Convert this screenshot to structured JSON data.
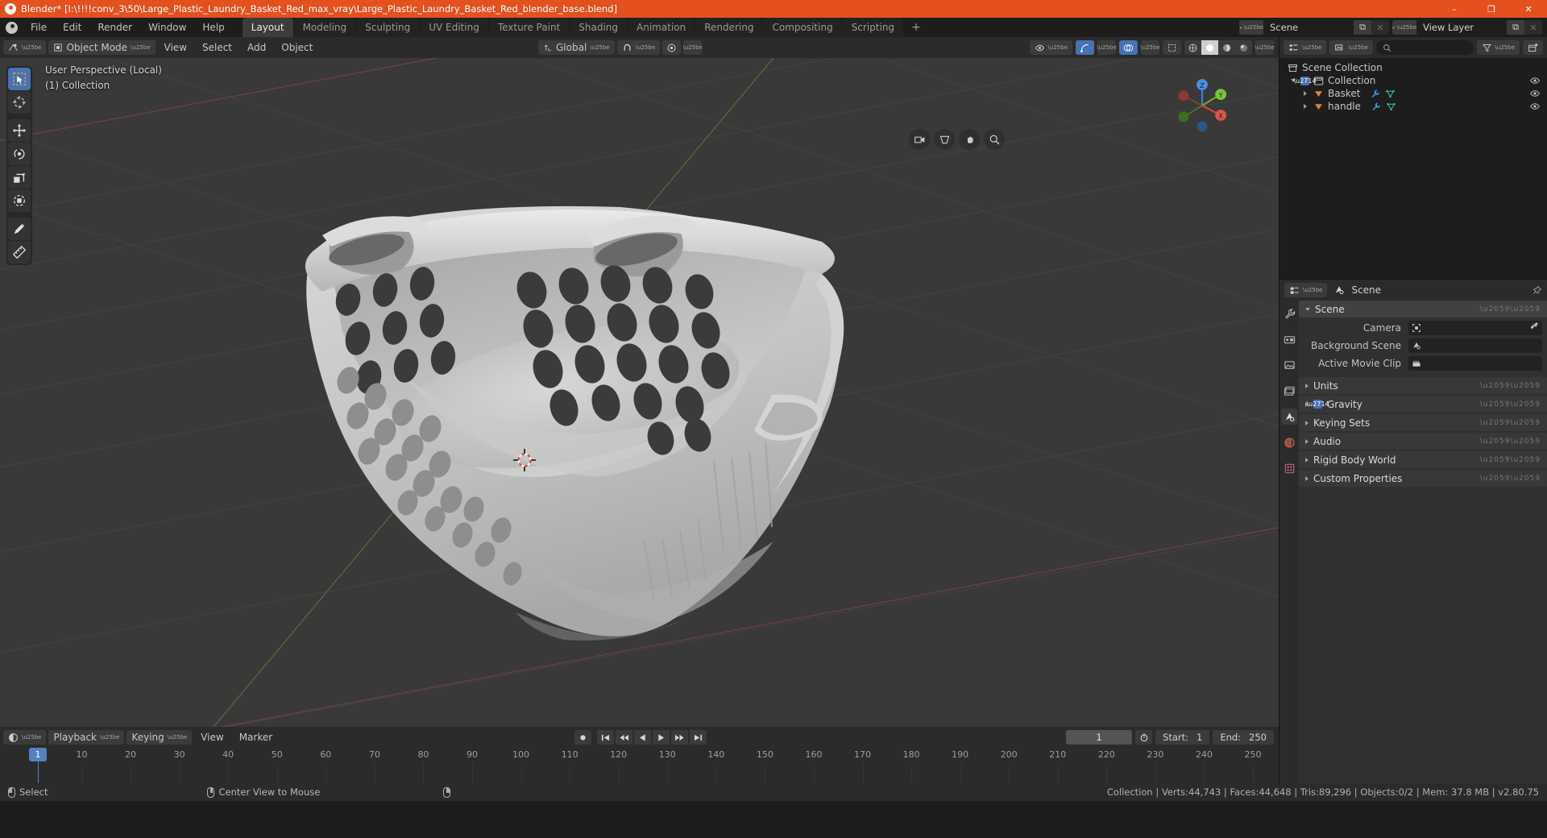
{
  "titlebar": {
    "app": "Blender*",
    "full_title": "Blender* [I:\\!!!!conv_3\\50\\Large_Plastic_Laundry_Basket_Red_max_vray\\Large_Plastic_Laundry_Basket_Red_blender_base.blend]",
    "minimize": "–",
    "maximize": "❐",
    "close": "✕"
  },
  "topbar": {
    "menus": [
      "File",
      "Edit",
      "Render",
      "Window",
      "Help"
    ],
    "workspaces": [
      {
        "label": "Layout",
        "active": true
      },
      {
        "label": "Modeling",
        "active": false
      },
      {
        "label": "Sculpting",
        "active": false
      },
      {
        "label": "UV Editing",
        "active": false
      },
      {
        "label": "Texture Paint",
        "active": false
      },
      {
        "label": "Shading",
        "active": false
      },
      {
        "label": "Animation",
        "active": false
      },
      {
        "label": "Rendering",
        "active": false
      },
      {
        "label": "Compositing",
        "active": false
      },
      {
        "label": "Scripting",
        "active": false
      }
    ],
    "add_workspace": "+",
    "scene_name": "Scene",
    "view_layer_name": "View Layer",
    "new_copy": "⧉",
    "unlink": "✕"
  },
  "viewport_header": {
    "editor_type": "editor-type-3d-view",
    "mode": "Object Mode",
    "menus": [
      "View",
      "Select",
      "Add",
      "Object"
    ],
    "transform_orientation": "Global",
    "snap_label": "snap-magnet",
    "proportional_label": "proportional-editing"
  },
  "viewport": {
    "perspective_text": "User Perspective (Local)",
    "collection_text": "(1) Collection",
    "gizmo_axes": {
      "x": "X",
      "y": "Y",
      "z": "Z"
    },
    "tools": [
      {
        "name": "select-box-tool",
        "active": true
      },
      {
        "name": "cursor-tool",
        "active": false
      },
      {
        "name": "move-tool",
        "active": false
      },
      {
        "name": "rotate-tool",
        "active": false
      },
      {
        "name": "scale-tool",
        "active": false
      },
      {
        "name": "transform-tool",
        "active": false
      },
      {
        "name": "annotate-tool",
        "active": false
      },
      {
        "name": "measure-tool",
        "active": false
      }
    ]
  },
  "outliner": {
    "search_placeholder": "",
    "rows": [
      {
        "label": "Scene Collection",
        "depth": 0,
        "icon": "collection-icon",
        "expand": "",
        "checkbox": false,
        "eye": false
      },
      {
        "label": "Collection",
        "depth": 1,
        "icon": "collection-icon",
        "expand": "down",
        "checkbox": true,
        "eye": true
      },
      {
        "label": "Basket",
        "depth": 2,
        "icon": "mesh-object-icon",
        "expand": "right",
        "checkbox": false,
        "eye": true,
        "extra": [
          "modifier-wrench-icon",
          "mesh-data-icon"
        ]
      },
      {
        "label": "handle",
        "depth": 2,
        "icon": "mesh-object-icon",
        "expand": "right",
        "checkbox": false,
        "eye": true,
        "extra": [
          "modifier-wrench-icon",
          "mesh-data-icon"
        ]
      }
    ]
  },
  "properties": {
    "breadcrumb": "Scene",
    "tabs": [
      {
        "name": "tool-tab",
        "active": false
      },
      {
        "name": "render-tab",
        "active": false
      },
      {
        "name": "output-tab",
        "active": false
      },
      {
        "name": "view-layer-tab",
        "active": false
      },
      {
        "name": "scene-tab",
        "active": true
      },
      {
        "name": "world-tab",
        "active": false
      },
      {
        "name": "texture-tab",
        "active": false
      }
    ],
    "scene_panel": {
      "title": "Scene",
      "open": true,
      "fields": [
        {
          "label": "Camera",
          "value": "",
          "icon": "camera-icon",
          "eyedropper": true
        },
        {
          "label": "Background Scene",
          "value": "",
          "icon": "scene-icon",
          "eyedropper": false
        },
        {
          "label": "Active Movie Clip",
          "value": "",
          "icon": "clip-icon",
          "eyedropper": false
        }
      ]
    },
    "sections": [
      {
        "label": "Units",
        "open": false,
        "checkbox": null
      },
      {
        "label": "Gravity",
        "open": false,
        "checkbox": true
      },
      {
        "label": "Keying Sets",
        "open": false,
        "checkbox": null
      },
      {
        "label": "Audio",
        "open": false,
        "checkbox": null
      },
      {
        "label": "Rigid Body World",
        "open": false,
        "checkbox": null
      },
      {
        "label": "Custom Properties",
        "open": false,
        "checkbox": null
      }
    ]
  },
  "timeline": {
    "menus": [
      "Playback",
      "Keying",
      "View",
      "Marker"
    ],
    "current_frame": "1",
    "start_label": "Start:",
    "start_value": "1",
    "end_label": "End:",
    "end_value": "250",
    "ticks": [
      "1",
      "10",
      "20",
      "30",
      "40",
      "50",
      "60",
      "70",
      "80",
      "90",
      "100",
      "110",
      "120",
      "130",
      "140",
      "150",
      "160",
      "170",
      "180",
      "190",
      "200",
      "210",
      "220",
      "230",
      "240",
      "250"
    ],
    "playback_buttons": [
      "record-icon",
      "jump-start-icon",
      "prev-keyframe-icon",
      "play-reverse-icon",
      "play-icon",
      "next-keyframe-icon",
      "jump-end-icon"
    ]
  },
  "statusbar": {
    "left_items": [
      {
        "mouse": "left",
        "label": "Select"
      },
      {
        "mouse": "middle",
        "label": "Center View to Mouse"
      },
      {
        "mouse": "right",
        "label": ""
      }
    ],
    "stats": "Collection | Verts:44,743 | Faces:44,648 | Tris:89,296 | Objects:0/2 | Mem: 37.8 MB | v2.80.75"
  },
  "colors": {
    "accent_orange": "#e4501e",
    "accent_blue": "#4772b3",
    "viewport_bg": "#393939",
    "panel_bg": "#303030",
    "header_bg": "#2b2b2b"
  }
}
